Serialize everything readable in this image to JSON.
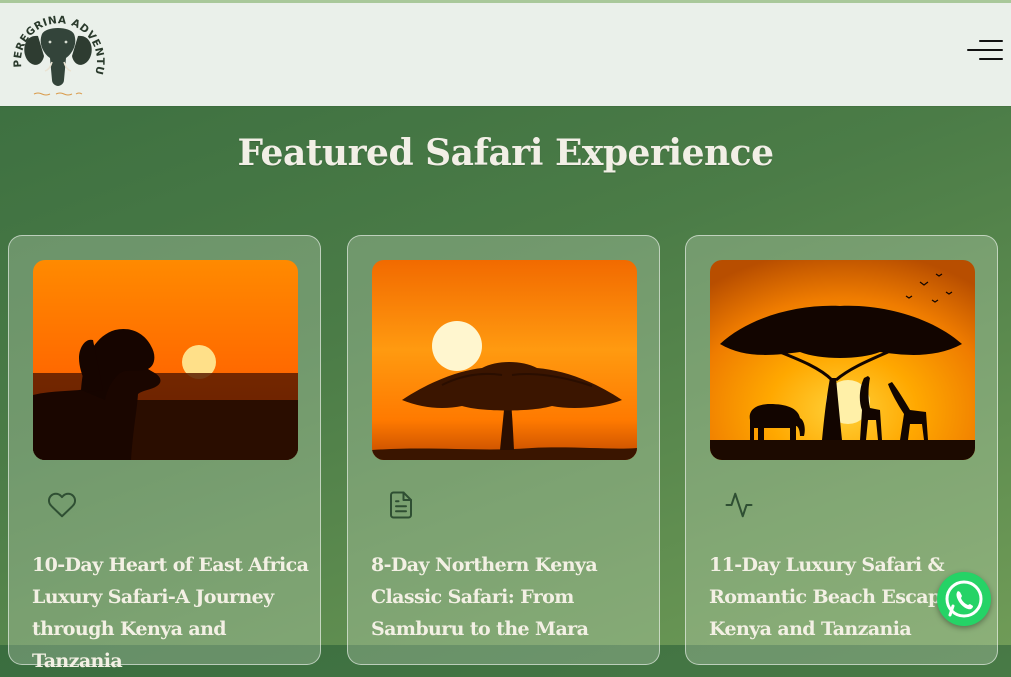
{
  "brand": {
    "name": "PEREGRINA ADVENTURES",
    "tagline": "~~~~ ~~~~",
    "colors": {
      "header_bg": "#eaf0ea",
      "section_bg_start": "#3a6d3f",
      "section_bg_end": "#6f9b57",
      "title_text": "#f2efe6",
      "icon_stroke": "#2f4f33",
      "whatsapp": "#25d366"
    }
  },
  "header": {
    "logo_icon": "elephant-head-icon",
    "menu_icon": "hamburger-menu-icon"
  },
  "section": {
    "title": "Featured Safari Experience"
  },
  "cards": [
    {
      "title": "10-Day Heart of East Africa Luxury Safari-A Journey through Kenya and Tanzania",
      "image": "lion-sunset-image",
      "icon": "heart-icon"
    },
    {
      "title": "8-Day Northern Kenya Classic Safari: From Samburu to the Mara",
      "image": "acacia-sunset-image",
      "icon": "document-icon"
    },
    {
      "title": "11-Day Luxury Safari & Romantic Beach Escape to Kenya and Tanzania",
      "image": "savanna-wildlife-sunset-image",
      "icon": "activity-pulse-icon"
    }
  ],
  "floating": {
    "whatsapp_icon": "whatsapp-icon"
  }
}
